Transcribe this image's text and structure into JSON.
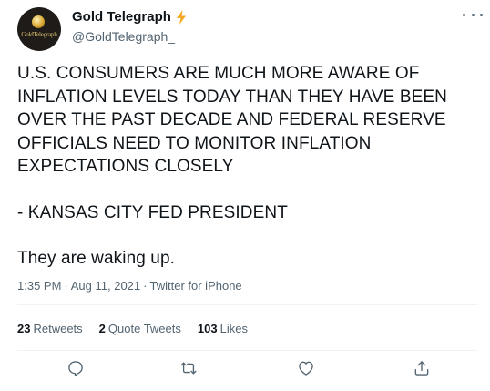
{
  "author": {
    "display_name": "Gold Telegraph",
    "handle": "@GoldTelegraph_",
    "avatar_text": "GoldTelegraph"
  },
  "tweet": {
    "paragraphs": [
      "U.S. CONSUMERS ARE MUCH MORE AWARE OF\nINFLATION LEVELS TODAY THAN THEY HAVE BEEN\nOVER THE PAST DECADE AND FEDERAL RESERVE\nOFFICIALS NEED TO MONITOR INFLATION\nEXPECTATIONS CLOSELY",
      "- KANSAS CITY FED PRESIDENT",
      "They are waking up."
    ],
    "time": "1:35 PM",
    "date": "Aug 11, 2021",
    "source": "Twitter for iPhone",
    "separator": "·"
  },
  "stats": {
    "retweets_count": "23",
    "retweets_label": "Retweets",
    "quote_count": "2",
    "quote_label": "Quote Tweets",
    "likes_count": "103",
    "likes_label": "Likes"
  },
  "icons": {
    "verified": "lightning-bolt-icon",
    "more": "more-icon",
    "reply": "reply-icon",
    "retweet": "retweet-icon",
    "like": "heart-icon",
    "share": "share-icon"
  },
  "colors": {
    "text": "#0f1419",
    "secondary": "#536471",
    "bolt": "#f5a623",
    "divider": "#eff3f4"
  }
}
